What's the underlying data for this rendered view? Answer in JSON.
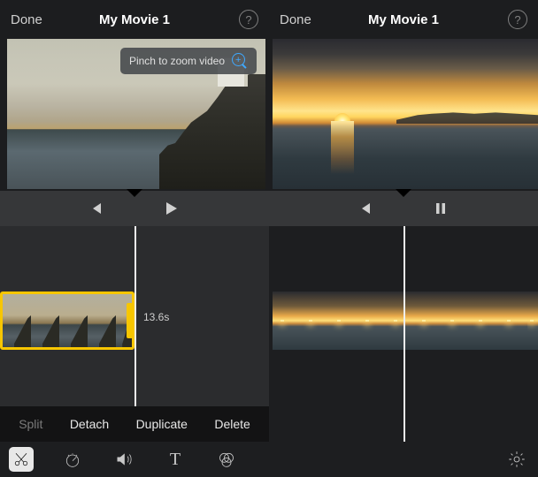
{
  "left": {
    "nav": {
      "done": "Done",
      "title": "My Movie 1",
      "help": "?"
    },
    "hint": {
      "text": "Pinch to zoom video"
    },
    "transport_state": "paused",
    "clip": {
      "duration_label": "13.6s",
      "selected": true
    },
    "clip_actions": {
      "split": "Split",
      "detach": "Detach",
      "duplicate": "Duplicate",
      "delete": "Delete"
    },
    "toolbar": {
      "cut": "cut",
      "speed": "speed",
      "volume": "volume",
      "text": "T",
      "filters": "filters"
    }
  },
  "right": {
    "nav": {
      "done": "Done",
      "title": "My Movie 1",
      "help": "?"
    },
    "transport_state": "playing",
    "settings_icon": "gear"
  }
}
